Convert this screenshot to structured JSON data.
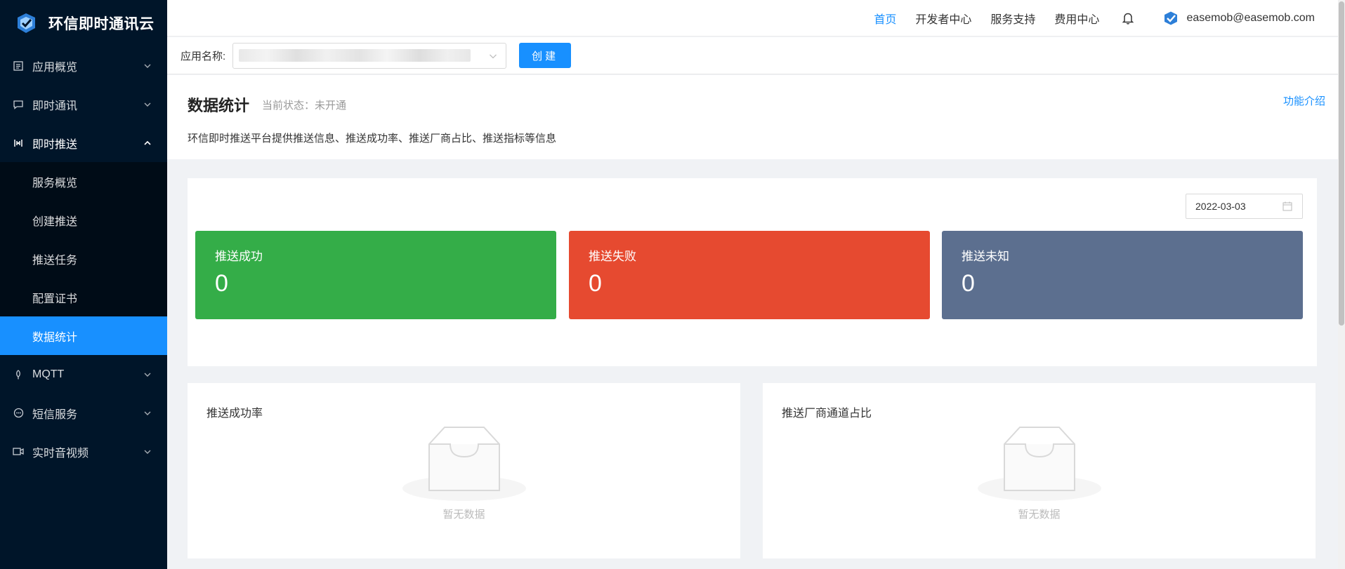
{
  "brand": {
    "name": "环信即时通讯云",
    "logo": "easemob-logo-icon"
  },
  "sidebar": {
    "items": [
      {
        "label": "应用概览",
        "icon": "overview-icon",
        "expanded": false
      },
      {
        "label": "即时通讯",
        "icon": "chat-icon",
        "expanded": false
      },
      {
        "label": "即时推送",
        "icon": "push-icon",
        "expanded": true,
        "children": [
          {
            "label": "服务概览",
            "active": false
          },
          {
            "label": "创建推送",
            "active": false
          },
          {
            "label": "推送任务",
            "active": false
          },
          {
            "label": "配置证书",
            "active": false
          },
          {
            "label": "数据统计",
            "active": true
          }
        ]
      },
      {
        "label": "MQTT",
        "icon": "mqtt-icon",
        "expanded": false
      },
      {
        "label": "短信服务",
        "icon": "sms-icon",
        "expanded": false
      },
      {
        "label": "实时音视频",
        "icon": "video-icon",
        "expanded": false
      }
    ]
  },
  "topnav": {
    "links": [
      {
        "label": "首页",
        "active": true
      },
      {
        "label": "开发者中心",
        "active": false
      },
      {
        "label": "服务支持",
        "active": false
      },
      {
        "label": "费用中心",
        "active": false
      }
    ],
    "user": "easemob@easemob.com"
  },
  "appbar": {
    "label": "应用名称:",
    "create_label": "创建"
  },
  "page": {
    "title": "数据统计",
    "status": "当前状态：未开通",
    "intro_link": "功能介绍",
    "description": "环信即时推送平台提供推送信息、推送成功率、推送厂商占比、推送指标等信息"
  },
  "stats": {
    "date": "2022-03-03",
    "cards": [
      {
        "label": "推送成功",
        "value": "0",
        "color": "#34ad48"
      },
      {
        "label": "推送失败",
        "value": "0",
        "color": "#e64a30"
      },
      {
        "label": "推送未知",
        "value": "0",
        "color": "#5c6f8f"
      }
    ]
  },
  "charts": {
    "success_rate": {
      "title": "推送成功率",
      "empty_text": "暂无数据"
    },
    "vendor_share": {
      "title": "推送厂商通道占比",
      "empty_text": "暂无数据"
    }
  },
  "colors": {
    "accent": "#1890ff",
    "sidebar_bg": "#001529",
    "submenu_bg": "#000c17"
  }
}
